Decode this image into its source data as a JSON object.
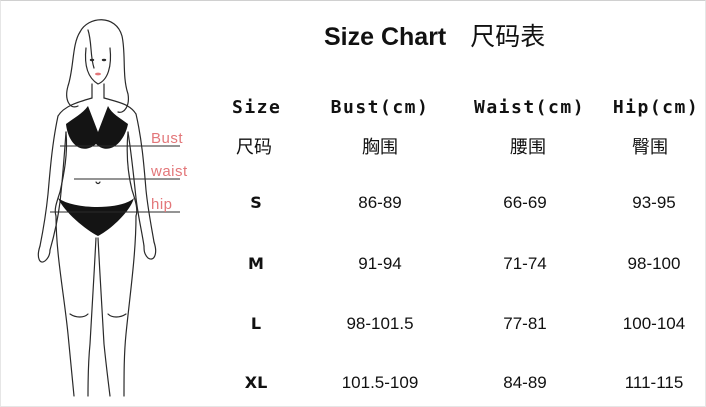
{
  "title": {
    "en": "Size Chart",
    "zh": "尺码表"
  },
  "figure_labels": {
    "bust": "Bust",
    "waist": "waist",
    "hip": "hip"
  },
  "colors": {
    "label": "#e3777a",
    "text": "#111111",
    "background": "#ffffff"
  },
  "headers": [
    {
      "en": "Size",
      "zh": "尺码"
    },
    {
      "en": "Bust(cm)",
      "zh": "胸围"
    },
    {
      "en": "Waist(cm)",
      "zh": "腰围"
    },
    {
      "en": "Hip(cm)",
      "zh": "臀围"
    }
  ],
  "rows": [
    {
      "size": "S",
      "bust": "86-89",
      "waist": "66-69",
      "hip": "93-95"
    },
    {
      "size": "M",
      "bust": "91-94",
      "waist": "71-74",
      "hip": "98-100"
    },
    {
      "size": "L",
      "bust": "98-101.5",
      "waist": "77-81",
      "hip": "100-104"
    },
    {
      "size": "XL",
      "bust": "101.5-109",
      "waist": "84-89",
      "hip": "111-115"
    }
  ]
}
